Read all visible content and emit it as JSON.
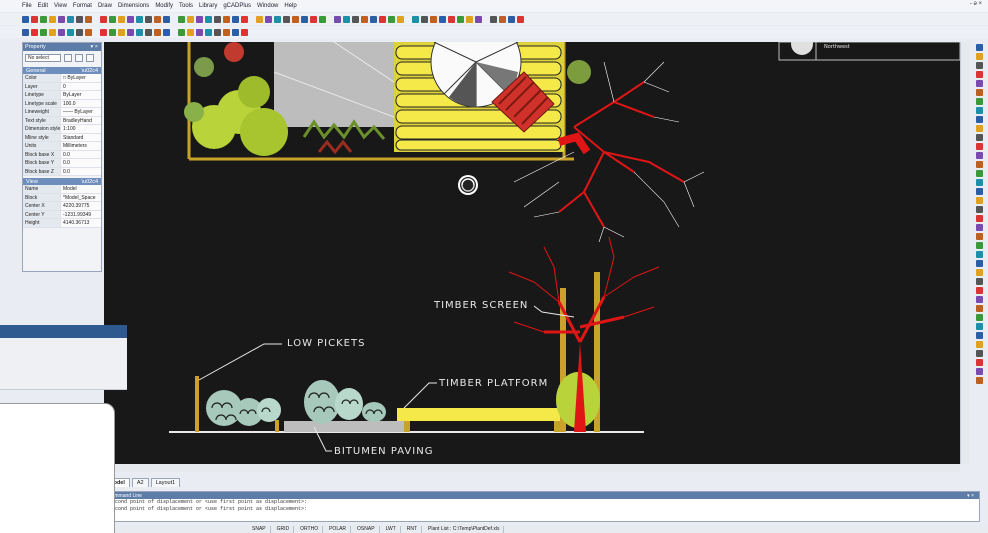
{
  "menu": [
    "File",
    "Edit",
    "View",
    "Format",
    "Draw",
    "Dimensions",
    "Modify",
    "Tools",
    "Library",
    "gCADPlus",
    "Window",
    "Help"
  ],
  "window_controls": "- ə ×",
  "property_panel": {
    "title": "Property",
    "title_controls": "▾ ×",
    "select_value": "No select",
    "general_title": "General",
    "general_rows": [
      {
        "k": "Color",
        "v": "□ ByLayer"
      },
      {
        "k": "Layer",
        "v": "0"
      },
      {
        "k": "Linetype",
        "v": "ByLayer"
      },
      {
        "k": "Linetype scale",
        "v": "100.0"
      },
      {
        "k": "Lineweight",
        "v": "—— ByLayer"
      },
      {
        "k": "Text style",
        "v": "BradleyHand"
      },
      {
        "k": "Dimension style",
        "v": "1:100"
      },
      {
        "k": "Mline style",
        "v": "Standard"
      },
      {
        "k": "Units",
        "v": "Millimeters"
      },
      {
        "k": "Block base X",
        "v": "0.0"
      },
      {
        "k": "Block base Y",
        "v": "0.0"
      },
      {
        "k": "Block base Z",
        "v": "0.0"
      }
    ],
    "view_title": "View",
    "view_rows": [
      {
        "k": "Name",
        "v": "Model"
      },
      {
        "k": "Block",
        "v": "*Model_Space"
      },
      {
        "k": "Center X",
        "v": "4220.39775"
      },
      {
        "k": "Center Y",
        "v": "-1231.99349"
      },
      {
        "k": "Height",
        "v": "4140.36713"
      }
    ]
  },
  "drawing_labels": {
    "low_pickets": "LOW PICKETS",
    "timber_platform": "TIMBER PLATFORM",
    "timber_screen": "TIMBER SCREEN",
    "bitumen_paving": "BITUMEN PAVING"
  },
  "title_block_text": "Northwest",
  "tabs": [
    "Model",
    "A2",
    "Layout1"
  ],
  "command": {
    "title": "Command Line",
    "controls": "▾ ×",
    "lines": [
      "Second point of displacement or <use first point as displacement>:",
      "Second point of displacement or <use first point as displacement>:"
    ]
  },
  "status": [
    "SNAP",
    "GRID",
    "ORTHO",
    "POLAR",
    "OSNAP",
    "LWT",
    "RNT",
    "Plant List : C:\\Temp\\PlantDef.xls"
  ],
  "colors": {
    "canvas": "#181818",
    "deck_yellow": "#f5e94a",
    "tree_red": "#e01515",
    "timber_gold": "#c9a22a",
    "shrub_green": "#b9d33a"
  }
}
